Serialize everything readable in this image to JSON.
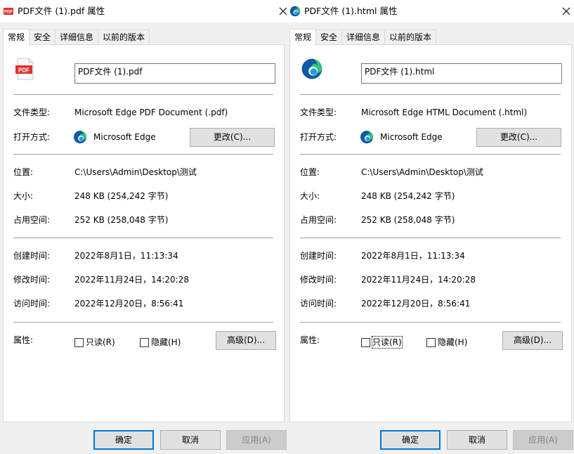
{
  "left": {
    "title": "PDF文件 (1).pdf 属性",
    "tabs": [
      "常规",
      "安全",
      "详细信息",
      "以前的版本"
    ],
    "filename": "PDF文件 (1).pdf",
    "file_type_label": "文件类型:",
    "file_type_value": "Microsoft Edge PDF Document (.pdf)",
    "open_with_label": "打开方式:",
    "open_with_app": "Microsoft Edge",
    "change_button": "更改(C)...",
    "location_label": "位置:",
    "location_value": "C:\\Users\\Admin\\Desktop\\测试",
    "size_label": "大小:",
    "size_value": "248 KB (254,242 字节)",
    "disk_size_label": "占用空间:",
    "disk_size_value": "252 KB (258,048 字节)",
    "created_label": "创建时间:",
    "created_value": "2022年8月1日，11:13:34",
    "modified_label": "修改时间:",
    "modified_value": "2022年11月24日，14:20:28",
    "accessed_label": "访问时间:",
    "accessed_value": "2022年12月20日，8:56:41",
    "attributes_label": "属性:",
    "readonly_label": "只读(R)",
    "hidden_label": "隐藏(H)",
    "advanced_button": "高级(D)...",
    "ok_button": "确定",
    "cancel_button": "取消",
    "apply_button": "应用(A)",
    "pdf_icon_text": "PDF"
  },
  "right": {
    "title": "PDF文件 (1).html 属性",
    "tabs": [
      "常规",
      "安全",
      "详细信息",
      "以前的版本"
    ],
    "filename": "PDF文件 (1).html",
    "file_type_label": "文件类型:",
    "file_type_value": "Microsoft Edge HTML Document (.html)",
    "open_with_label": "打开方式:",
    "open_with_app": "Microsoft Edge",
    "change_button": "更改(C)...",
    "location_label": "位置:",
    "location_value": "C:\\Users\\Admin\\Desktop\\测试",
    "size_label": "大小:",
    "size_value": "248 KB (254,242 字节)",
    "disk_size_label": "占用空间:",
    "disk_size_value": "252 KB (258,048 字节)",
    "created_label": "创建时间:",
    "created_value": "2022年8月1日，11:13:34",
    "modified_label": "修改时间:",
    "modified_value": "2022年11月24日，14:20:28",
    "accessed_label": "访问时间:",
    "accessed_value": "2022年12月20日，8:56:41",
    "attributes_label": "属性:",
    "readonly_label": "只读(R)",
    "hidden_label": "隐藏(H)",
    "advanced_button": "高级(D)...",
    "ok_button": "确定",
    "cancel_button": "取消",
    "apply_button": "应用(A)"
  },
  "colors": {
    "accent": "#0078d7",
    "pdf_red": "#e0302d",
    "edge_blue": "#0c59a4",
    "edge_green": "#37c17a"
  },
  "icons": {
    "pdf_file": "pdf-file-icon",
    "edge": "edge-icon",
    "close": "close-icon"
  }
}
